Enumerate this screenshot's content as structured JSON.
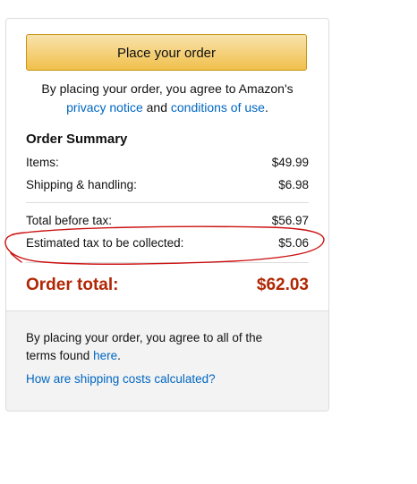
{
  "place_order": {
    "button_label": "Place your order"
  },
  "agreement": {
    "prefix": "By placing your order, you agree to Amazon's",
    "privacy_link": "privacy notice",
    "and_text": "and",
    "conditions_link": "conditions of use",
    "period": "."
  },
  "order_summary": {
    "title": "Order Summary",
    "items_label": "Items:",
    "items_value": "$49.99",
    "shipping_label": "Shipping & handling:",
    "shipping_value": "$6.98",
    "total_before_tax_label": "Total before tax:",
    "total_before_tax_value": "$56.97",
    "estimated_tax_label": "Estimated tax to be collected:",
    "estimated_tax_value": "$5.06",
    "order_total_label": "Order total:",
    "order_total_value": "$62.03"
  },
  "footer": {
    "terms_text": "By placing your order, you agree to all of the terms found",
    "here_link": "here",
    "period": ".",
    "shipping_link": "How are shipping costs calculated?"
  },
  "colors": {
    "accent_link": "#0066c0",
    "order_total": "#b12704",
    "button_fill": "#f1c04b",
    "annotation_circle": "#cc1111"
  }
}
